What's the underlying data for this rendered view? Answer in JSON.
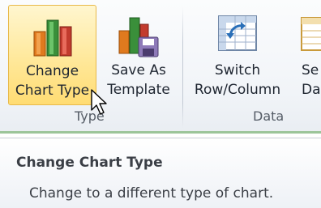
{
  "ribbon": {
    "change_chart_type": {
      "line1": "Change",
      "line2": "Chart Type",
      "icon": "bar-chart-icon"
    },
    "save_as_template": {
      "line1": "Save As",
      "line2": "Template",
      "icon": "save-template-icon"
    },
    "switch_row_column": {
      "line1": "Switch",
      "line2": "Row/Column",
      "icon": "switch-icon"
    },
    "select_data": {
      "line1": "Se",
      "line2": "Da",
      "icon": "select-data-icon"
    },
    "groups": {
      "type": "Type",
      "data": "Data"
    }
  },
  "tooltip": {
    "title": "Change Chart Type",
    "description": "Change to a different type of chart."
  }
}
